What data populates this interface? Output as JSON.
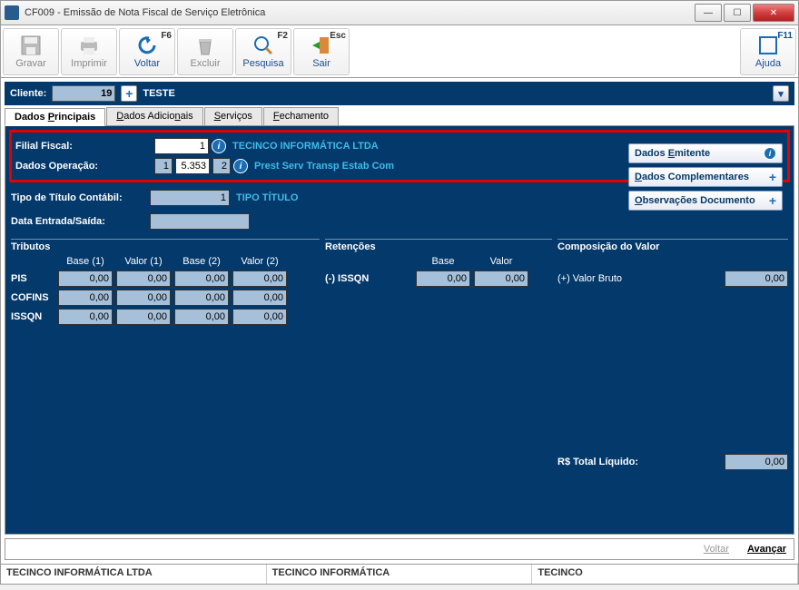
{
  "window": {
    "title": "CF009 - Emissão de Nota Fiscal de Serviço Eletrônica"
  },
  "toolbar": {
    "gravar": "Gravar",
    "imprimir": "Imprimir",
    "voltar": "Voltar",
    "voltar_key": "F6",
    "excluir": "Excluir",
    "pesquisa": "Pesquisa",
    "pesquisa_key": "F2",
    "sair": "Sair",
    "sair_key": "Esc",
    "ajuda": "Ajuda",
    "ajuda_key": "F11"
  },
  "client": {
    "label": "Cliente:",
    "value": "19",
    "name": "TESTE"
  },
  "tabs": {
    "t1": "Dados Principais",
    "t2": "Dados Adicionais",
    "t3": "Serviços",
    "t4": "Fechamento"
  },
  "form": {
    "filial_lbl": "Filial Fiscal:",
    "filial_val": "1",
    "filial_desc": "TECINCO INFORMÁTICA LTDA",
    "oper_lbl": "Dados Operação:",
    "oper_v1": "1",
    "oper_v2": "5.353",
    "oper_v3": "2",
    "oper_desc": "Prest Serv Transp Estab Com",
    "titulo_lbl": "Tipo de Título Contábil:",
    "titulo_val": "1",
    "titulo_desc": "TIPO TÍTULO",
    "data_lbl": "Data Entrada/Saída:",
    "data_val": ""
  },
  "side": {
    "emitente": "Dados Emitente",
    "complementares": "Dados Complementares",
    "observacoes": "Observações Documento"
  },
  "tributos": {
    "title": "Tributos",
    "h_base1": "Base (1)",
    "h_val1": "Valor (1)",
    "h_base2": "Base (2)",
    "h_val2": "Valor (2)",
    "rows": [
      {
        "lbl": "PIS",
        "b1": "0,00",
        "v1": "0,00",
        "b2": "0,00",
        "v2": "0,00"
      },
      {
        "lbl": "COFINS",
        "b1": "0,00",
        "v1": "0,00",
        "b2": "0,00",
        "v2": "0,00"
      },
      {
        "lbl": "ISSQN",
        "b1": "0,00",
        "v1": "0,00",
        "b2": "0,00",
        "v2": "0,00"
      }
    ]
  },
  "retencoes": {
    "title": "Retenções",
    "h_base": "Base",
    "h_val": "Valor",
    "row_lbl": "(-) ISSQN",
    "row_b": "0,00",
    "row_v": "0,00"
  },
  "composicao": {
    "title": "Composição do Valor",
    "bruto_lbl": "(+) Valor Bruto",
    "bruto_val": "0,00",
    "total_lbl": "R$ Total Líquido:",
    "total_val": "0,00"
  },
  "nav": {
    "voltar": "Voltar",
    "avancar": "Avançar"
  },
  "status": {
    "s1": "TECINCO INFORMÁTICA LTDA",
    "s2": "TECINCO INFORMÁTICA",
    "s3": "TECINCO"
  }
}
